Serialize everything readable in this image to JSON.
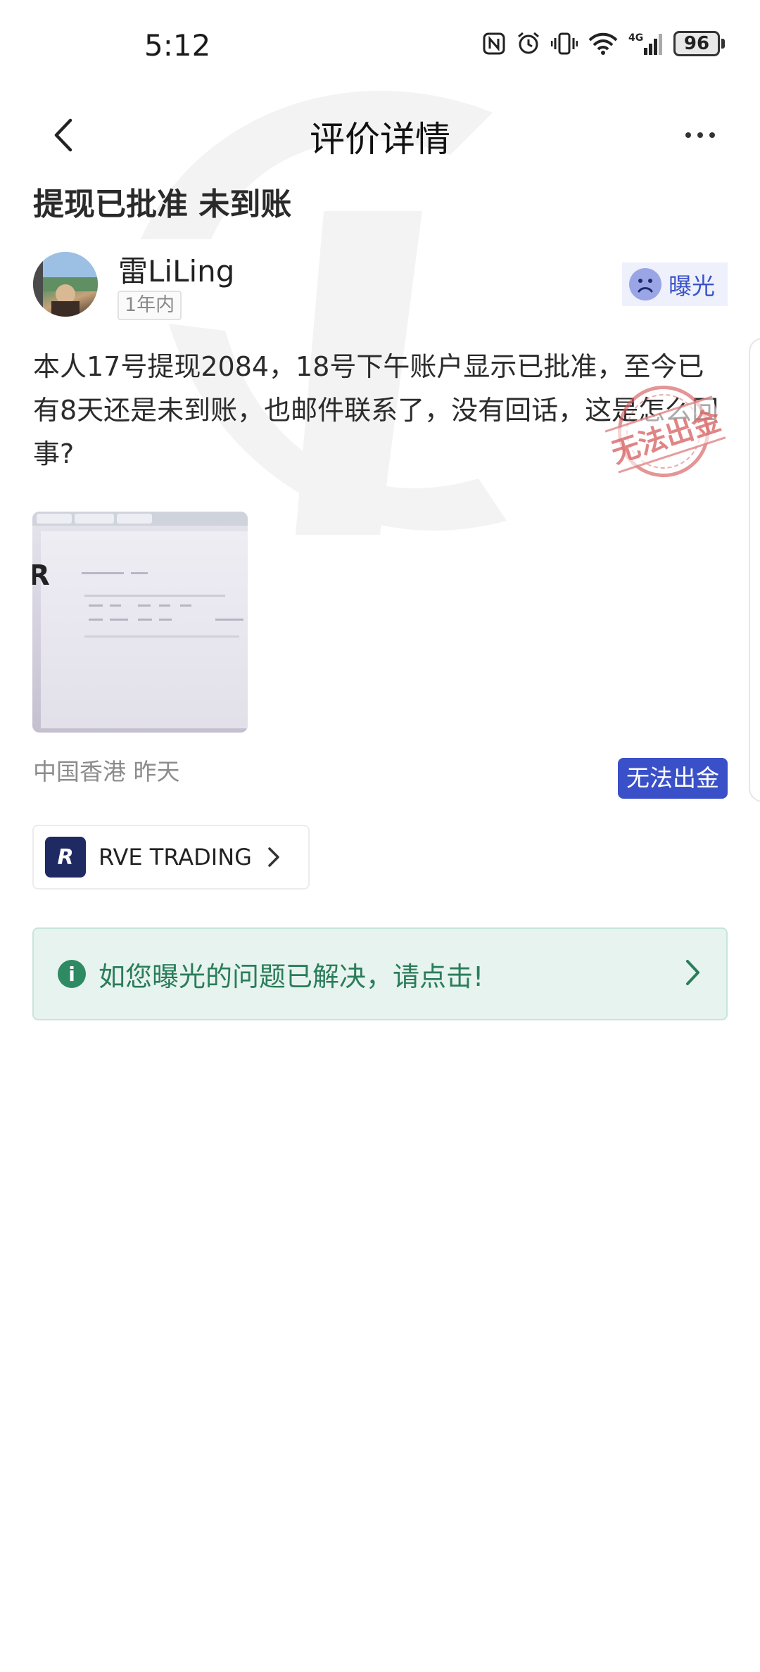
{
  "status_bar": {
    "time": "5:12",
    "battery": "96",
    "icons": [
      "nfc-icon",
      "alarm-icon",
      "vibrate-icon",
      "wifi-icon",
      "signal-4g-icon",
      "battery-icon"
    ]
  },
  "nav": {
    "title": "评价详情",
    "back_icon": "chevron-left-icon",
    "more_icon": "more-horizontal-icon"
  },
  "post": {
    "title": "提现已批准 未到账",
    "author": "雷LiLing",
    "time_badge": "1年内",
    "tag": "曝光",
    "body": "本人17号提现2084，18号下午账户显示已批准，至今已有8天还是未到账，也邮件联系了，没有回话，这是怎么回事?",
    "stamp_text": "无法出金",
    "location_time": "中国香港 昨天",
    "status_label": "无法出金"
  },
  "company": {
    "logo_text": "R",
    "name": "RVE TRADING"
  },
  "resolved_banner": {
    "text": "如您曝光的问题已解决，请点击!"
  },
  "colors": {
    "accent_blue": "#3a50c8",
    "resolved_green": "#2a7d5a",
    "resolved_bg": "#e7f3ef",
    "stamp_red": "#d65c5c"
  }
}
